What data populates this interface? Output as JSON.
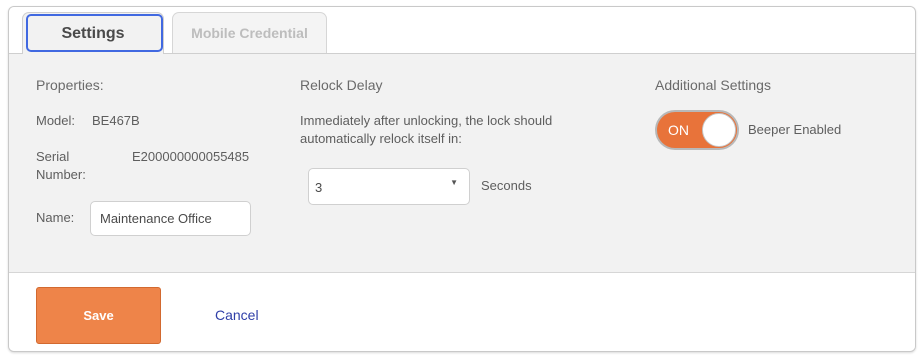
{
  "tabs": [
    {
      "label": "Settings",
      "active": true
    },
    {
      "label": "Mobile Credential",
      "active": false
    }
  ],
  "properties": {
    "heading": "Properties:",
    "model_label": "Model:",
    "model_value": "BE467B",
    "serial_label_line1": "Serial",
    "serial_label_line2": "Number:",
    "serial_value": "E200000000055485",
    "name_label": "Name:",
    "name_value": "Maintenance Office"
  },
  "relock": {
    "heading": "Relock Delay",
    "description_line1": "Immediately after unlocking, the lock should",
    "description_line2": "automatically relock itself in:",
    "selected_value": "3",
    "unit_label": "Seconds"
  },
  "additional": {
    "heading": "Additional Settings",
    "toggle_state_text": "ON",
    "toggle_label": "Beeper Enabled",
    "toggle_on": true
  },
  "footer": {
    "save_label": "Save",
    "cancel_label": "Cancel"
  },
  "colors": {
    "accent_orange": "#ee8449",
    "tab_highlight": "#4169e1",
    "link_blue": "#2f3fa8"
  }
}
